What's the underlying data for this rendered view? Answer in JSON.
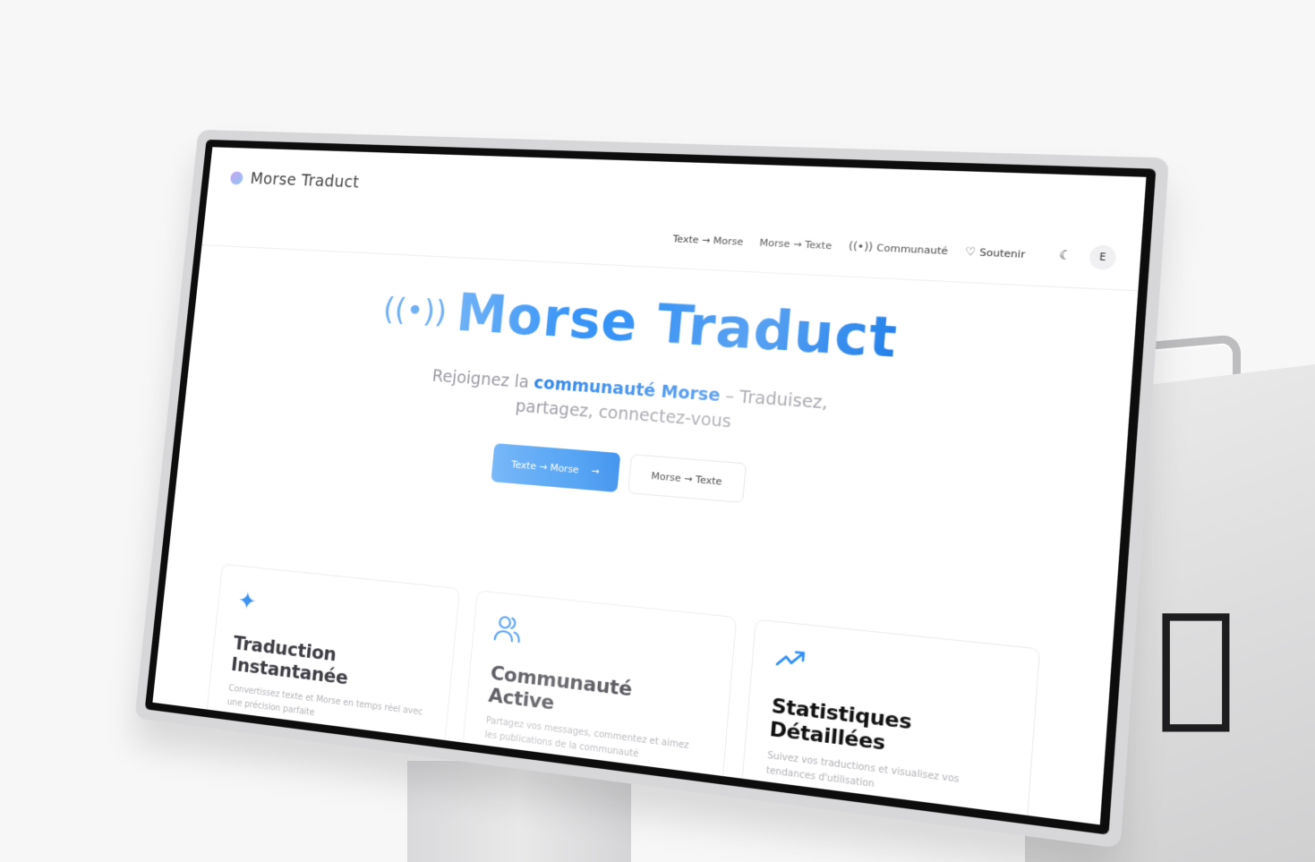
{
  "brand": {
    "name": "Morse Traduct"
  },
  "nav": {
    "items": [
      {
        "label": "Texte → Morse",
        "icon": ""
      },
      {
        "label": "Morse → Texte",
        "icon": ""
      },
      {
        "label": "Communauté",
        "icon": "radio-waves-icon"
      },
      {
        "label": "Soutenir",
        "icon": "heart-icon"
      }
    ],
    "avatar": "E"
  },
  "hero": {
    "title": "Morse Traduct",
    "subtitle_pre": "Rejoignez la ",
    "subtitle_highlight": "communauté Morse",
    "subtitle_post": " – Traduisez, partagez, connectez-vous",
    "primary_cta": "Texte → Morse",
    "secondary_cta": "Morse → Texte"
  },
  "features": [
    {
      "icon": "sparkle-icon",
      "title": "Traduction Instantanée",
      "desc": "Convertissez texte et Morse en temps réel avec une précision parfaite"
    },
    {
      "icon": "users-icon",
      "title": "Communauté Active",
      "desc": "Partagez vos messages, commentez et aimez les publications de la communauté"
    },
    {
      "icon": "trending-up-icon",
      "title": "Statistiques Détaillées",
      "desc": "Suivez vos traductions et visualisez vos tendances d'utilisation"
    }
  ],
  "colors": {
    "accent": "#2b8df5",
    "accent_light": "#78b8f8",
    "text_muted": "#9a9aa3"
  }
}
